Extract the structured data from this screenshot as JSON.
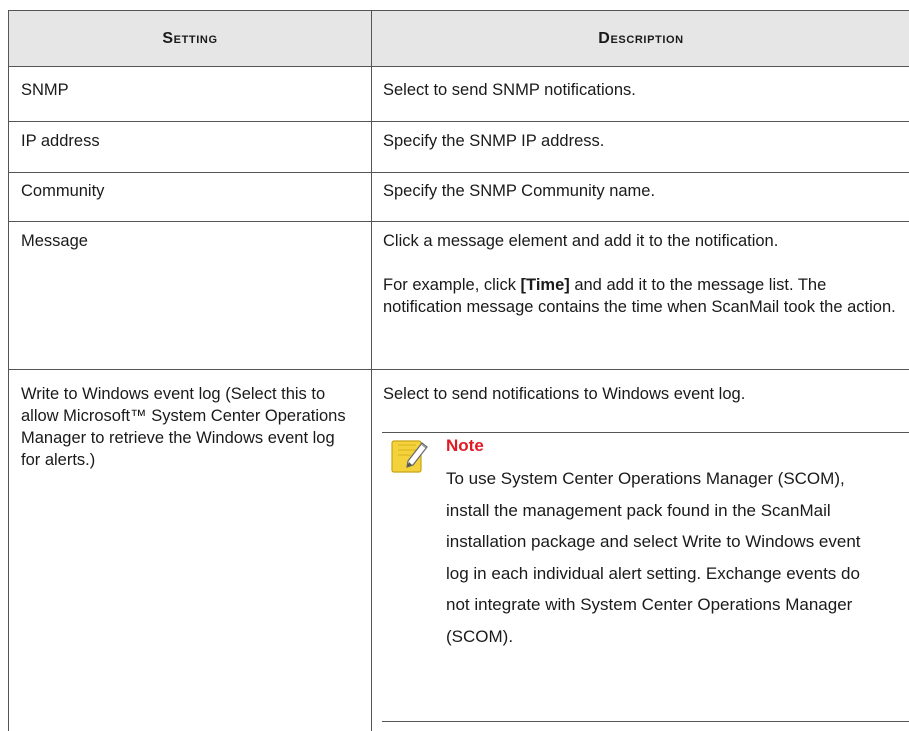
{
  "table": {
    "headers": {
      "setting": "Setting",
      "description": "Description"
    },
    "rows": [
      {
        "setting": "SNMP",
        "description": [
          "Select to send SNMP notifications."
        ]
      },
      {
        "setting": "IP address",
        "description": [
          "Specify the SNMP IP address."
        ]
      },
      {
        "setting": "Community",
        "description": [
          "Specify the SNMP Community name."
        ]
      },
      {
        "setting": "Message",
        "description": [
          "Click a message element and add it to the notification.",
          "For example, click",
          "[Time]",
          " and add it to the message list. The notification message contains the time when ScanMail took the action."
        ]
      },
      {
        "setting": "Write to Windows event log (Select this to allow Microsoft™ System Center Operations Manager to retrieve the Windows event log for alerts.)",
        "description": [
          "Select to send notifications to Windows event log."
        ]
      }
    ]
  },
  "note": {
    "icon": "pencil-note-icon",
    "title": "Note",
    "body": "To use System Center Operations Manager (SCOM), install the management pack found in the ScanMail installation package and select Write to Windows event log in each individual alert setting. Exchange events do not integrate with System Center Operations Manager (SCOM)."
  }
}
